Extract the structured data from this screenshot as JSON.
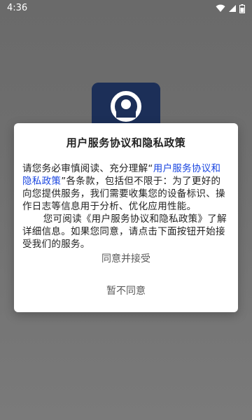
{
  "status_bar": {
    "time": "4:36",
    "icons": [
      "wifi-icon",
      "signal-icon",
      "battery-icon"
    ]
  },
  "app_logo": {
    "icon": "app-logo-icon",
    "color": "#1c2f58"
  },
  "dialog": {
    "title": "用户服务协议和隐私政策",
    "paragraph1": {
      "prefix": "请您务必审慎阅读、充分理解“",
      "link": "用户服务协议和隐私政策",
      "suffix": "”各条款，包括但不限于：为了更好的向您提供服务，我们需要收集您的设备标识、操作日志等信息用于分析、优化应用性能。"
    },
    "paragraph2": "您可阅读《用户服务协议和隐私政策》了解详细信息。如果您同意，请点击下面按钮开始接受我们的服务。",
    "agree_button": "同意并接受",
    "disagree_button": "暂不同意"
  },
  "colors": {
    "link": "#1a46e0",
    "overlay": "#6b6b6b",
    "dialog_bg": "#ffffff"
  }
}
